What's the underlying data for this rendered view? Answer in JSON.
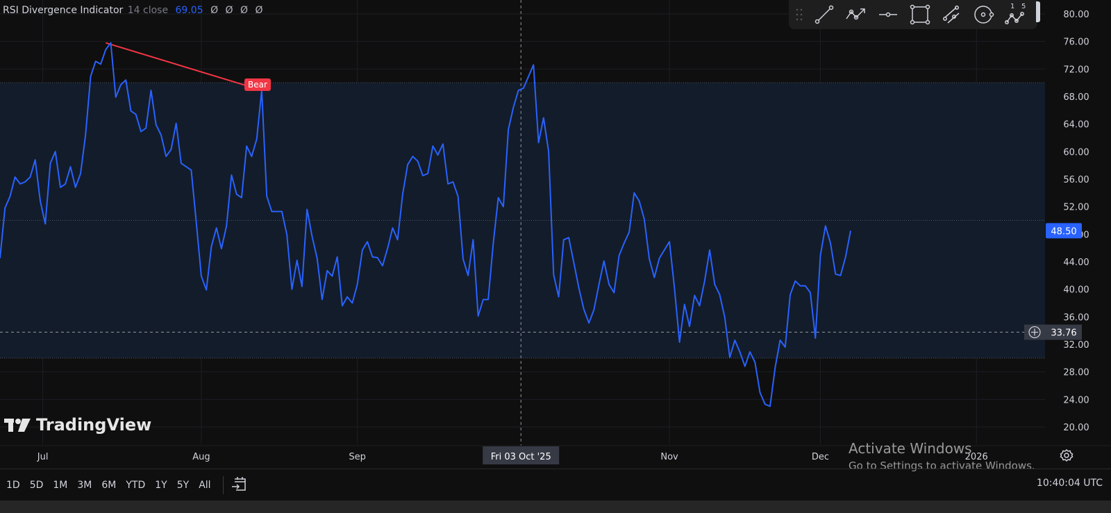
{
  "indicator": {
    "name": "RSI Divergence Indicator",
    "params": "14 close",
    "value": "69.05",
    "na_values": [
      "Ø",
      "Ø",
      "Ø",
      "Ø"
    ]
  },
  "toolbar": {
    "icons": [
      "grip-icon",
      "trend-line-icon",
      "path-arrow-icon",
      "horizontal-ray-icon",
      "rectangle-icon",
      "parallel-channel-icon",
      "circle-icon",
      "xabcd-pattern-icon"
    ],
    "pattern_labels": [
      "1",
      "5"
    ]
  },
  "annotation": {
    "bear_label": "Bear"
  },
  "logo": {
    "text": "TradingView"
  },
  "crosshair": {
    "date_label": "Fri 03 Oct '25",
    "value_label": "33.76",
    "value": 33.76
  },
  "last_value_label": "48.50",
  "bottom_bar": {
    "ranges": [
      "1D",
      "5D",
      "1M",
      "3M",
      "6M",
      "YTD",
      "1Y",
      "5Y",
      "All"
    ],
    "clock": "10:40:04 UTC"
  },
  "watermark": {
    "title": "Activate Windows",
    "subtitle": "Go to Settings to activate Windows."
  },
  "colors": {
    "line": "#2962ff",
    "bear": "#f23645",
    "band": "#131c2a",
    "bg": "#0f0f0f"
  },
  "chart_data": {
    "type": "line",
    "title": "RSI Divergence Indicator",
    "ylim": [
      20,
      80
    ],
    "y_ticks": [
      "80.00",
      "76.00",
      "72.00",
      "68.00",
      "64.00",
      "60.00",
      "56.00",
      "52.00",
      "48.00",
      "44.00",
      "40.00",
      "36.00",
      "32.00",
      "28.00",
      "24.00",
      "20.00"
    ],
    "y_tick_values": [
      80,
      76,
      72,
      68,
      64,
      60,
      56,
      52,
      48,
      44,
      40,
      36,
      32,
      28,
      24,
      20
    ],
    "x_ticks": [
      {
        "label": "Jul",
        "index": 8.5
      },
      {
        "label": "Aug",
        "index": 40
      },
      {
        "label": "Sep",
        "index": 71
      },
      {
        "label": "Nov",
        "index": 133
      },
      {
        "label": "Dec",
        "index": 163
      },
      {
        "label": "2026",
        "index": 194
      }
    ],
    "crosshair_index": 103.5,
    "bands": {
      "upper": 70,
      "middle": 50,
      "lower": 30
    },
    "divergence": {
      "type": "Bear",
      "from_index": 21,
      "from_value": 75.8,
      "to_index": 52,
      "to_value": 68.9
    },
    "series": [
      {
        "name": "RSI",
        "values": [
          44.5,
          51.8,
          53.5,
          56.3,
          55.3,
          55.6,
          56.3,
          58.8,
          52.8,
          49.5,
          58.3,
          60.0,
          54.8,
          55.3,
          57.8,
          54.8,
          56.8,
          62.4,
          70.9,
          73.1,
          72.7,
          74.8,
          75.8,
          67.9,
          69.7,
          70.4,
          65.9,
          65.4,
          62.9,
          63.4,
          68.9,
          63.9,
          62.4,
          59.3,
          60.3,
          64.1,
          58.3,
          57.8,
          57.3,
          49.7,
          41.9,
          39.9,
          46.2,
          48.9,
          45.9,
          49.2,
          56.6,
          53.8,
          53.3,
          60.8,
          59.3,
          61.8,
          68.9,
          53.5,
          51.3,
          51.3,
          51.3,
          47.9,
          40.0,
          44.2,
          40.4,
          51.6,
          47.7,
          44.5,
          38.5,
          42.7,
          41.9,
          44.7,
          37.6,
          38.9,
          38.0,
          40.7,
          45.7,
          46.9,
          44.7,
          44.6,
          43.4,
          45.9,
          48.9,
          47.2,
          53.8,
          58.1,
          59.3,
          58.6,
          56.5,
          56.8,
          60.8,
          59.5,
          61.1,
          55.3,
          55.6,
          53.5,
          44.4,
          42.0,
          47.2,
          36.1,
          38.5,
          38.5,
          46.7,
          53.3,
          52.0,
          63.2,
          66.4,
          68.9,
          69.2,
          70.9,
          72.6,
          61.3,
          64.9,
          60.0,
          42.1,
          38.9,
          47.2,
          47.5,
          43.9,
          40.2,
          37.1,
          35.1,
          37.0,
          40.7,
          44.1,
          40.7,
          39.5,
          44.9,
          46.7,
          48.3,
          54.0,
          52.8,
          50.2,
          44.4,
          41.7,
          44.5,
          45.7,
          46.9,
          40.2,
          32.3,
          37.8,
          34.6,
          39.1,
          37.6,
          41.2,
          45.7,
          40.7,
          39.2,
          35.9,
          30.1,
          32.6,
          30.9,
          28.8,
          30.9,
          29.4,
          25.0,
          23.3,
          23.0,
          28.6,
          32.6,
          31.6,
          39.2,
          41.2,
          40.5,
          40.5,
          39.5,
          32.9,
          44.9,
          49.2,
          46.7,
          42.2,
          42.0,
          44.7,
          48.5
        ]
      }
    ]
  }
}
